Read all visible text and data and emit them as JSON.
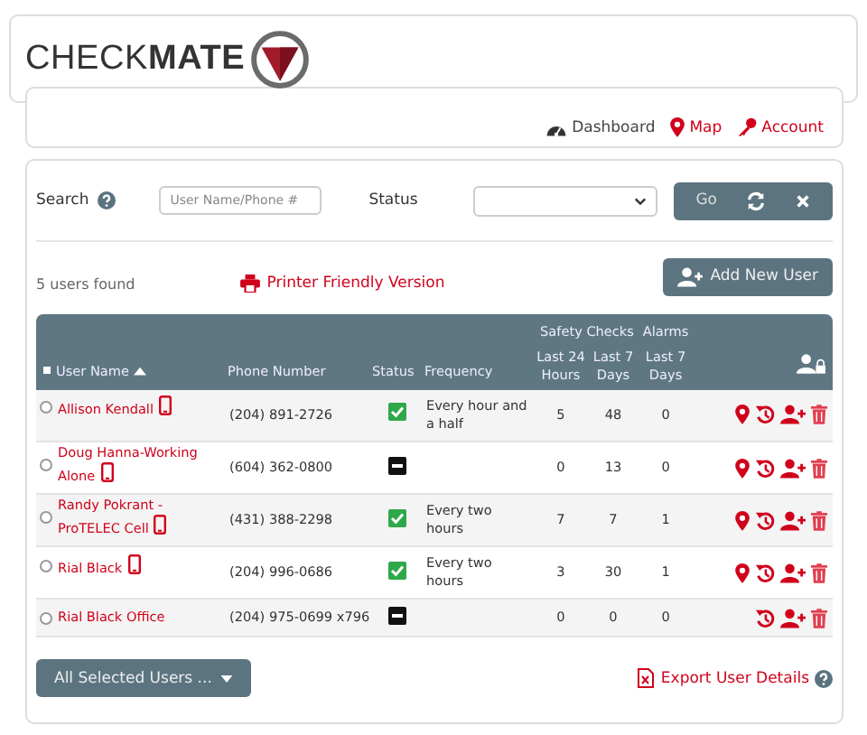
{
  "logo": {
    "text": "CHECK**MATE**"
  },
  "nav": [
    {
      "label": "Dashboard",
      "kind": "dashboard"
    },
    {
      "label": "Map",
      "kind": "map"
    },
    {
      "label": "Account",
      "kind": "account"
    }
  ],
  "search": {
    "label": "Search",
    "placeholder": "User Name/Phone #",
    "status_label": "Status",
    "buttons": {
      "go": "Go"
    }
  },
  "summary": {
    "count": "5 users found",
    "printer": "Printer Friendly Version",
    "add_user": "Add New User"
  },
  "table": {
    "group_headers": [
      "Safety Checks",
      "Alarms"
    ],
    "columns": [
      "User Name",
      "Phone Number",
      "Status",
      "Frequency",
      "Last 24 Hours",
      "Last 7 Days",
      "Last 7 Days"
    ],
    "rows": [
      {
        "selected": false,
        "name": "Allison Kendall",
        "mobile": true,
        "phone": "(204) 891-2726",
        "active": true,
        "frequency": "Every hour and a half",
        "checks_24h": "5",
        "checks_7d": "48",
        "alarms_7d": "0",
        "map": true
      },
      {
        "selected": false,
        "name": "Doug Hanna-Working Alone",
        "mobile": true,
        "phone": "(604) 362-0800",
        "active": false,
        "frequency": "",
        "checks_24h": "0",
        "checks_7d": "13",
        "alarms_7d": "0",
        "map": true
      },
      {
        "selected": false,
        "name": "Randy Pokrant - ProTELEC Cell",
        "mobile": true,
        "phone": "(431) 388-2298",
        "active": true,
        "frequency": "Every two hours",
        "checks_24h": "7",
        "checks_7d": "7",
        "alarms_7d": "1",
        "map": true
      },
      {
        "selected": false,
        "name": "Rial Black",
        "mobile": true,
        "phone": "(204) 996-0686",
        "active": true,
        "frequency": "Every two hours",
        "checks_24h": "3",
        "checks_7d": "30",
        "alarms_7d": "1",
        "map": true
      },
      {
        "selected": false,
        "name": "Rial Black Office",
        "mobile": false,
        "phone": "(204) 975-0699 x796",
        "active": false,
        "frequency": "",
        "checks_24h": "0",
        "checks_7d": "0",
        "alarms_7d": "0",
        "map": false
      }
    ]
  },
  "footer": {
    "bulk": "All Selected Users ...",
    "export": "Export User Details"
  }
}
